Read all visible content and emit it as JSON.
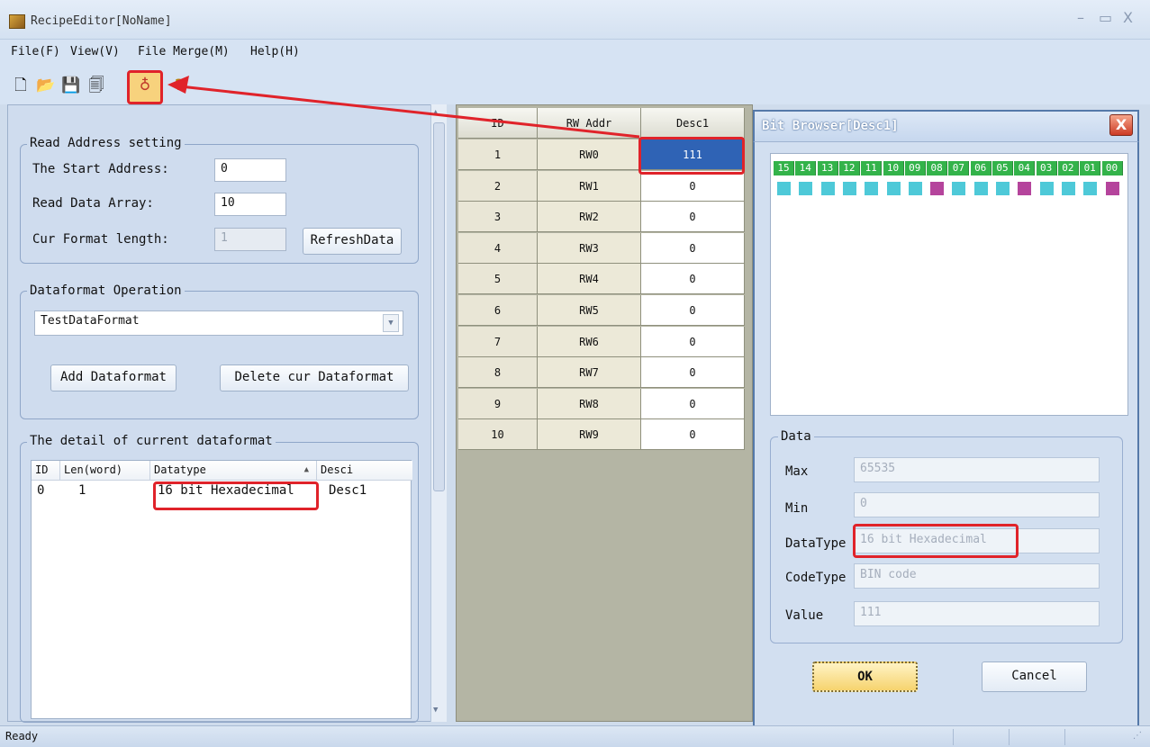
{
  "window": {
    "title": "RecipeEditor[NoName]",
    "minimize": "–",
    "maximize": "▭",
    "close": "X"
  },
  "menu": [
    "File(F)",
    "View(V)",
    "File Merge(M)",
    "Help(H)"
  ],
  "toolbar": {
    "icons": [
      "new-file-icon",
      "open-folder-icon",
      "save-icon",
      "save-as-icon",
      "bit-browser-icon",
      "help-icon"
    ],
    "glyphs": [
      "🗋",
      "📂",
      "💾",
      "🗐",
      "♁",
      "?"
    ]
  },
  "read_address": {
    "group_label": "Read Address setting",
    "start_label": "The Start Address:",
    "start_value": "0",
    "array_label": "Read Data Array:",
    "array_value": "10",
    "format_len_label": "Cur Format length:",
    "format_len_value": "1",
    "refresh_label": "RefreshData"
  },
  "dataformat": {
    "group_label": "Dataformat Operation",
    "selected": "TestDataFormat",
    "add_label": "Add Dataformat",
    "delete_label": "Delete cur Dataformat"
  },
  "detail": {
    "group_label": "The detail of current dataformat",
    "columns": [
      "ID",
      "Len(word)",
      "Datatype",
      "Desci"
    ],
    "sort_glyph": "▲",
    "rows": [
      [
        "0",
        "1",
        "16 bit Hexadecimal",
        "Desc1"
      ]
    ]
  },
  "grid": {
    "columns": [
      "ID",
      "RW Addr",
      "Desc1"
    ],
    "rows": [
      [
        "1",
        "RW0",
        "111"
      ],
      [
        "2",
        "RW1",
        "0"
      ],
      [
        "3",
        "RW2",
        "0"
      ],
      [
        "4",
        "RW3",
        "0"
      ],
      [
        "5",
        "RW4",
        "0"
      ],
      [
        "6",
        "RW5",
        "0"
      ],
      [
        "7",
        "RW6",
        "0"
      ],
      [
        "8",
        "RW7",
        "0"
      ],
      [
        "9",
        "RW8",
        "0"
      ],
      [
        "10",
        "RW9",
        "0"
      ]
    ]
  },
  "bit_browser": {
    "title": "Bit Browser[Desc1]",
    "bits": [
      "15",
      "14",
      "13",
      "12",
      "11",
      "10",
      "09",
      "08",
      "07",
      "06",
      "05",
      "04",
      "03",
      "02",
      "01",
      "00"
    ],
    "bit_states": [
      0,
      0,
      0,
      0,
      0,
      0,
      0,
      1,
      0,
      0,
      0,
      1,
      0,
      0,
      0,
      1
    ],
    "colors": {
      "off": "#4ec9d8",
      "on": "#b5449c"
    },
    "data_group_label": "Data",
    "max_label": "Max",
    "max_value": "65535",
    "min_label": "Min",
    "min_value": "0",
    "datatype_label": "DataType",
    "datatype_value": "16 bit Hexadecimal",
    "codetype_label": "CodeType",
    "codetype_value": "BIN code",
    "value_label": "Value",
    "value_value": "111",
    "ok_label": "OK",
    "cancel_label": "Cancel"
  },
  "status": {
    "text": "Ready"
  },
  "colors": {
    "highlight": "#e0232a",
    "selected_cell": "#2f63b5",
    "bit_header": "#33b34a"
  }
}
